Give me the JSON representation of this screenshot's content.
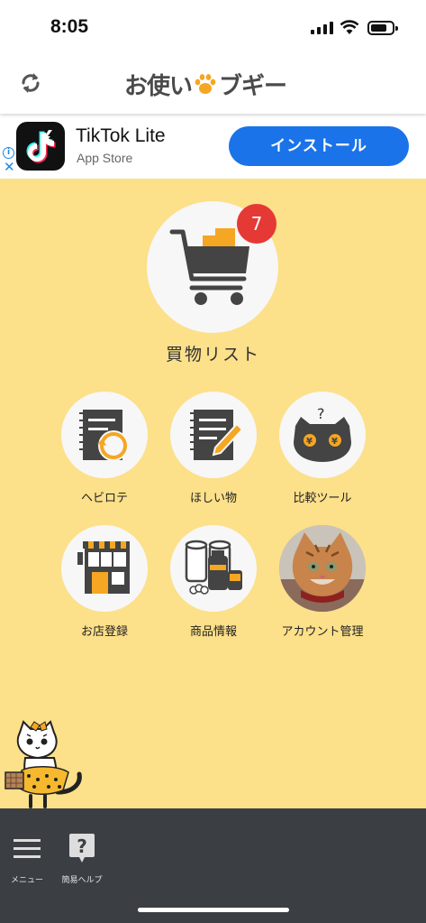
{
  "status": {
    "time": "8:05"
  },
  "header": {
    "logo_text_1": "お使い",
    "logo_text_2": "ブギー"
  },
  "ad": {
    "app_name": "TikTok Lite",
    "store": "App Store",
    "install_label": "インストール",
    "info_icon": "i",
    "close_icon": "✕"
  },
  "cart": {
    "badge": "7",
    "label": "買物リスト"
  },
  "tiles": [
    {
      "label": "ヘビロテ"
    },
    {
      "label": "ほしい物"
    },
    {
      "label": "比較ツール"
    },
    {
      "label": "お店登録"
    },
    {
      "label": "商品情報"
    },
    {
      "label": "アカウント管理"
    }
  ],
  "bottom_nav": [
    {
      "label": "メニュー",
      "icon": "menu-icon"
    },
    {
      "label": "簡易ヘルプ",
      "icon": "help-icon",
      "glyph": "?"
    }
  ],
  "colors": {
    "background": "#FCE08A",
    "accent_orange": "#F5A623",
    "badge_red": "#E53935",
    "install_blue": "#1A73E8",
    "bottom_bar": "#3B3F44"
  }
}
